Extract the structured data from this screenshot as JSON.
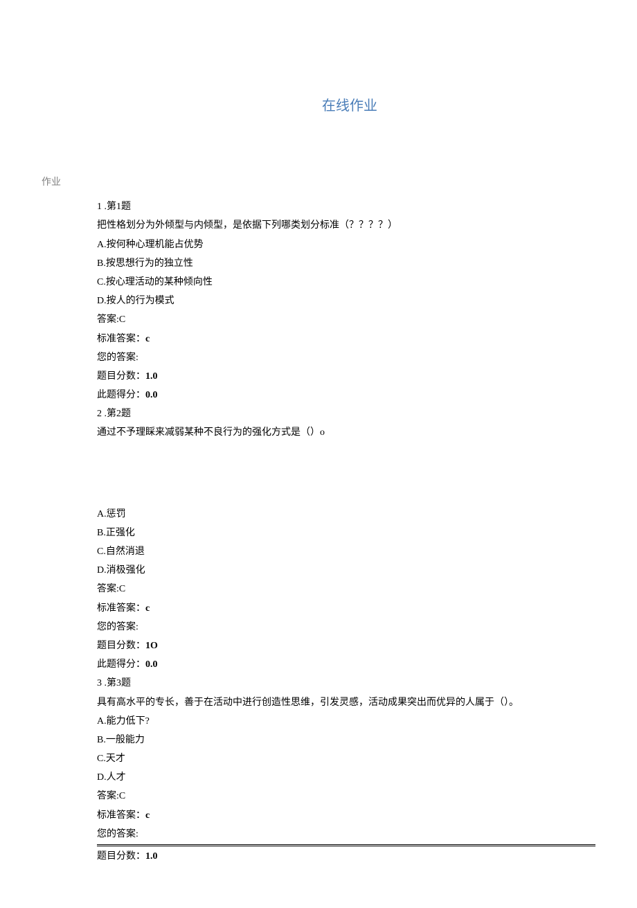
{
  "title": "在线作业",
  "sectionLabel": "作业",
  "q1": {
    "num": "1 .第1题",
    "stem": "把性格划分为外倾型与内倾型，是依据下列哪类划分标准（？？？？）",
    "optA": "A.按何种心理机能占优势",
    "optB": "B.按思想行为的独立性",
    "optC": "C.按心理活动的某种倾向性",
    "optD": "D.按人的行为模式",
    "ans": "答案:C",
    "stdLabel": "标准答案：",
    "stdVal": "c",
    "yourLabel": "您的答案:",
    "scoreLabel": "题目分数：",
    "scoreVal": "1.0",
    "gotLabel": "此题得分：",
    "gotVal": "0.0"
  },
  "q2": {
    "num": "2 .第2题",
    "stem": "通过不予理睬来减弱某种不良行为的强化方式是（）o",
    "optA": "A.惩罚",
    "optB": "B.正强化",
    "optC": "C.自然消退",
    "optD": "D.消极强化",
    "ans": "答案:C",
    "stdLabel": "标准答案：",
    "stdVal": "c",
    "yourLabel": "您的答案:",
    "scoreLabel": "题目分数：",
    "scoreVal": "1O",
    "gotLabel": "此题得分：",
    "gotVal": "0.0"
  },
  "q3": {
    "num": "3 .第3题",
    "stem": "具有高水平的专长，善于在活动中进行创造性思维，引发灵感，活动成果突出而优异的人属于（）。",
    "optA": "A.能力低下?",
    "optB": "B.一般能力",
    "optC": "C.天才",
    "optD": "D.人才",
    "ans": "答案:C",
    "stdLabel": "标准答案：",
    "stdVal": "c",
    "yourLabel": "您的答案:",
    "scoreLabel": "题目分数：",
    "scoreVal": "1.0"
  }
}
